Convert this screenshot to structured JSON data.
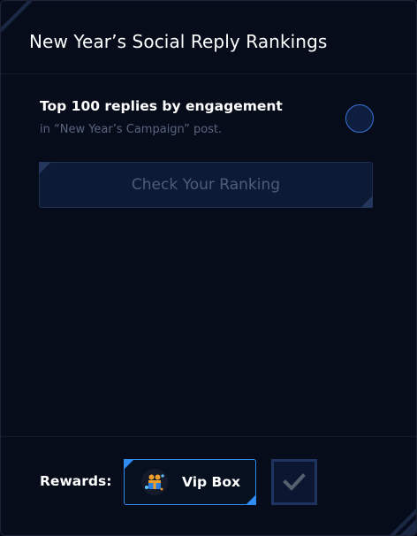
{
  "header": {
    "title": "New Year’s Social Reply Rankings"
  },
  "task": {
    "title": "Top 100 replies by engagement",
    "subtitle": "in “New Year’s Campaign” post."
  },
  "actions": {
    "check_label": "Check Your Ranking"
  },
  "rewards": {
    "label": "Rewards:",
    "items": [
      {
        "label": "Vip Box",
        "icon": "vip-box-icon"
      }
    ],
    "claim_icon": "checkmark-icon"
  },
  "colors": {
    "background": "#060c1a",
    "accent": "#2f8df2",
    "button_bg": "#0d1a36",
    "muted_text": "#4e5c7a"
  }
}
